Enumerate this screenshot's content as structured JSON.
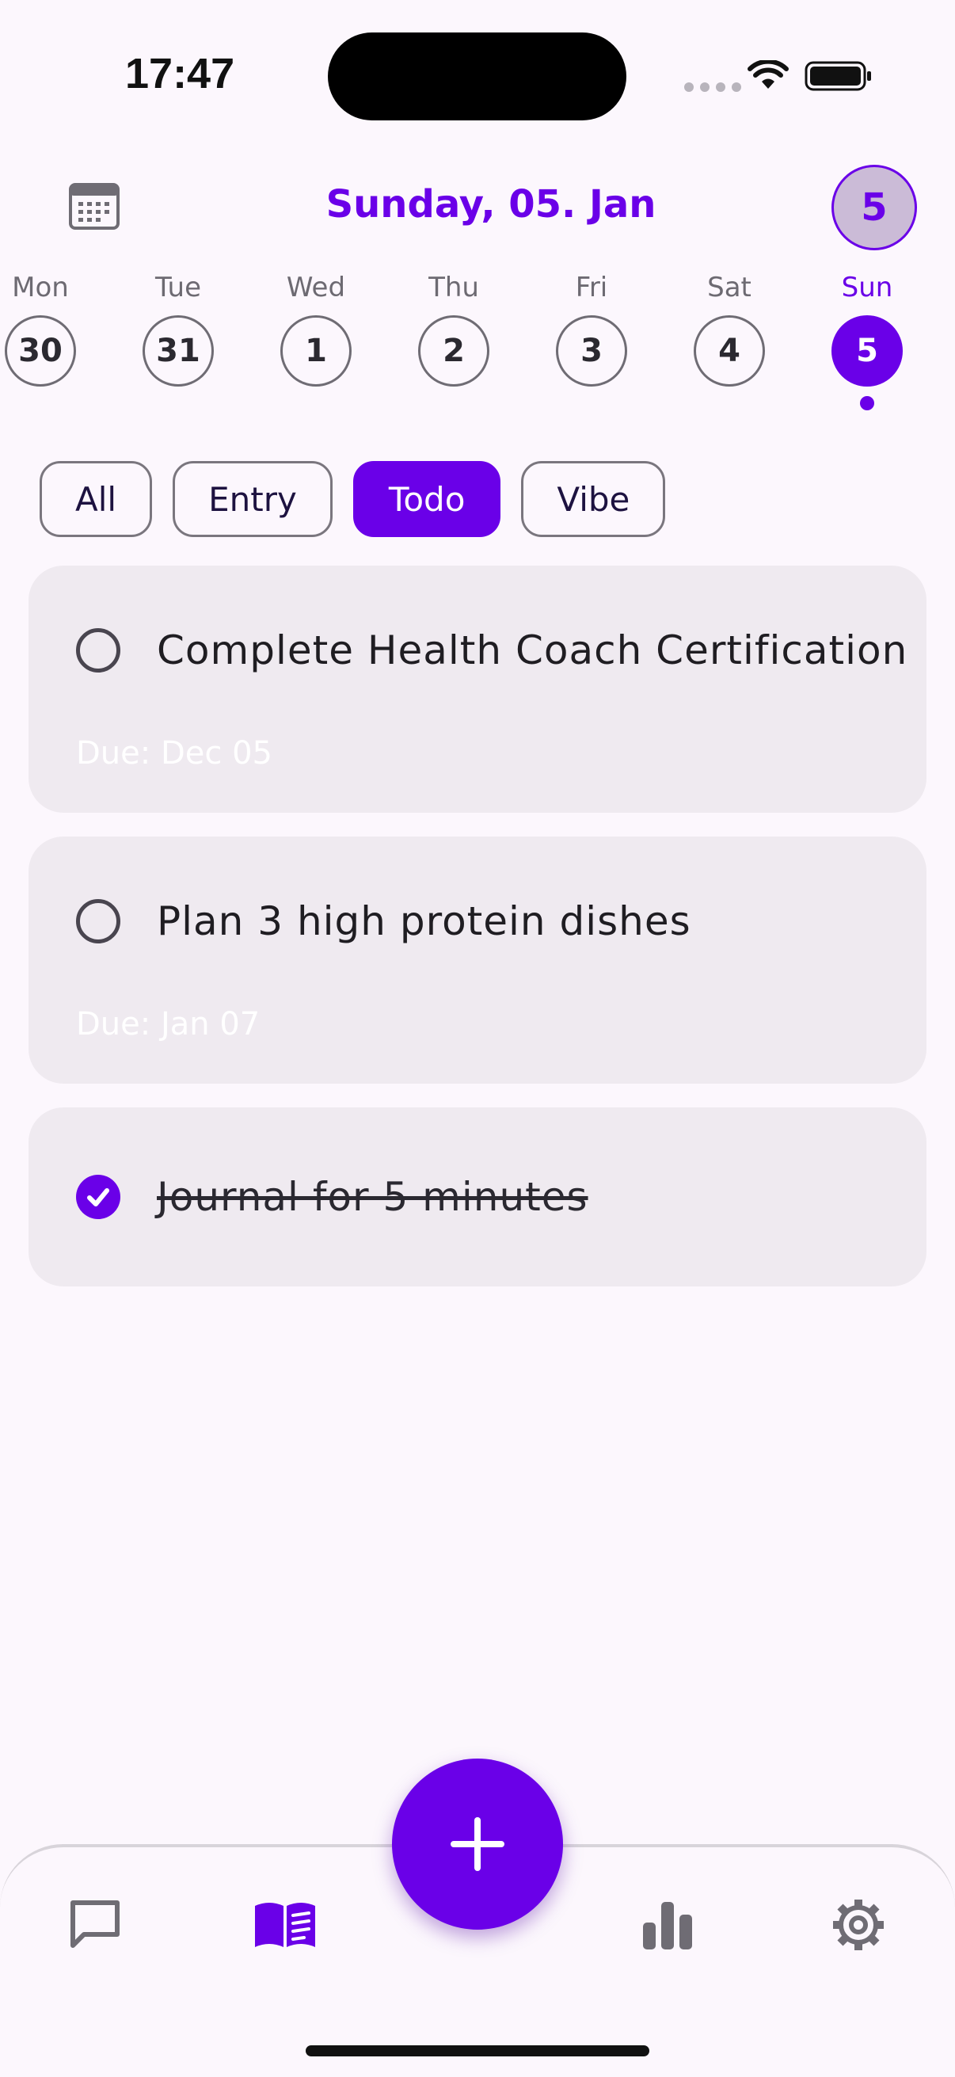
{
  "status_bar": {
    "time": "17:47"
  },
  "header": {
    "title": "Sunday, 05. Jan",
    "streak": "5"
  },
  "week": [
    {
      "name": "Mon",
      "num": "30"
    },
    {
      "name": "Tue",
      "num": "31"
    },
    {
      "name": "Wed",
      "num": "1"
    },
    {
      "name": "Thu",
      "num": "2"
    },
    {
      "name": "Fri",
      "num": "3"
    },
    {
      "name": "Sat",
      "num": "4"
    },
    {
      "name": "Sun",
      "num": "5"
    }
  ],
  "filters": [
    "All",
    "Entry",
    "Todo",
    "Vibe"
  ],
  "active_filter": "Todo",
  "todos": [
    {
      "text": "Complete Health Coach Certification",
      "due": "Due: Dec 05",
      "done": false
    },
    {
      "text": "Plan 3 high protein dishes",
      "due": "Due: Jan 07",
      "done": false
    },
    {
      "text": "Journal for 5 minutes",
      "due": "",
      "done": true
    }
  ],
  "nav": {
    "items": [
      "chat-icon",
      "journal-icon",
      "stats-icon",
      "settings-icon"
    ],
    "active": "journal-icon",
    "fab_icon": "plus-icon"
  },
  "colors": {
    "accent": "#6A00E8",
    "background": "#FCF7FD",
    "card": "#EFEAF0"
  }
}
